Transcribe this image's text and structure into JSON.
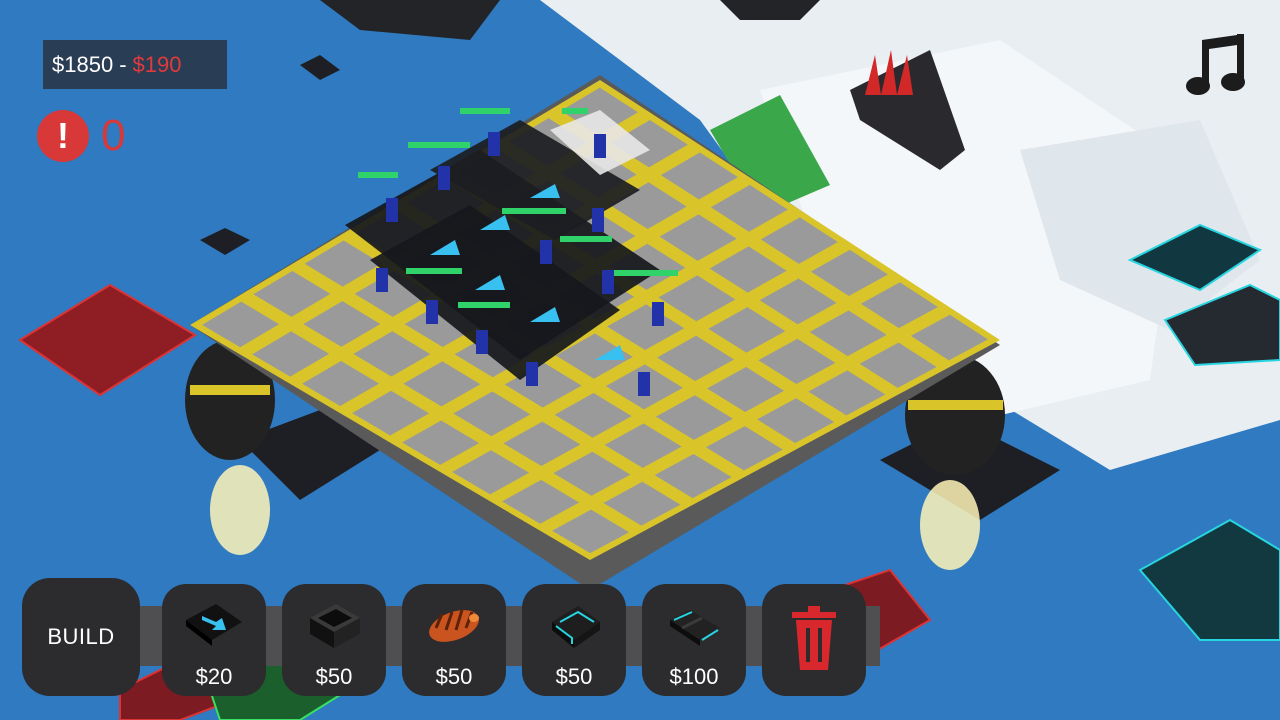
{
  "hud": {
    "money": "$1850",
    "separator": "-",
    "cost": "$190",
    "alert_symbol": "!",
    "alert_count": "0"
  },
  "toolbar": {
    "build_label": "BUILD",
    "items": [
      {
        "price": "$20",
        "icon": "conveyor-icon"
      },
      {
        "price": "$50",
        "icon": "machine-box-icon"
      },
      {
        "price": "$50",
        "icon": "drill-icon"
      },
      {
        "price": "$50",
        "icon": "splitter-icon"
      },
      {
        "price": "$100",
        "icon": "combiner-icon"
      }
    ],
    "delete_icon": "trash-icon"
  },
  "icons": {
    "music": "music-note-icon",
    "alert": "exclamation-icon"
  },
  "colors": {
    "sky": "#2f7ac0",
    "grid_border": "#d9c42a",
    "tile": "#9a9a9a",
    "alert_red": "#d93838",
    "toolbar_button": "#2c2c2e",
    "cost_red": "#e23a3a"
  }
}
